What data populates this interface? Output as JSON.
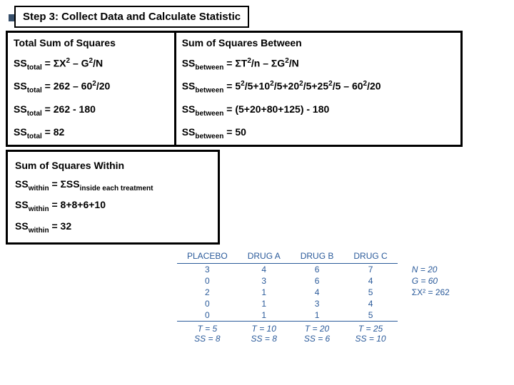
{
  "step_title": "Step 3: Collect Data and Calculate Statistic",
  "col1": {
    "header": "Total Sum of Squares",
    "r1a": "SS",
    "r1b": "total",
    "r1c": " = ΣX",
    "r1d": "2",
    "r1e": " – G",
    "r1f": "2",
    "r1g": "/N",
    "r2a": "SS",
    "r2b": "total",
    "r2c": " = 262 – 60",
    "r2d": "2",
    "r2e": "/20",
    "r3a": "SS",
    "r3b": "total",
    "r3c": " = 262 - 180",
    "r4a": "SS",
    "r4b": "total",
    "r4c": " = 82"
  },
  "col2": {
    "header": "Sum of Squares Between",
    "r1a": "SS",
    "r1b": "between",
    "r1c": " = ΣT",
    "r1d": "2",
    "r1e": "/n – ΣG",
    "r1f": "2",
    "r1g": "/N",
    "r2a": "SS",
    "r2b": "between",
    "r2c": " = 5",
    "r2d": "2",
    "r2e": "/5+10",
    "r2f": "2",
    "r2g": "/5+20",
    "r2h": "2",
    "r2i": "/5+25",
    "r2j": "2",
    "r2k": "/5 – 60",
    "r2l": "2",
    "r2m": "/20",
    "r3a": "SS",
    "r3b": "between",
    "r3c": " = (5+20+80+125) - 180",
    "r4a": "SS",
    "r4b": "between",
    "r4c": " = 50"
  },
  "within": {
    "header": "Sum of Squares Within",
    "r1a": "SS",
    "r1b": "within",
    "r1c": " = ΣSS",
    "r1d": "inside each treatment",
    "r2a": "SS",
    "r2b": "within",
    "r2c": " = 8+8+6+10",
    "r3a": "SS",
    "r3b": "within",
    "r3c": " = 32"
  },
  "datatable": {
    "h1": "PLACEBO",
    "h2": "DRUG A",
    "h3": "DRUG B",
    "h4": "DRUG C",
    "rows": [
      [
        "3",
        "4",
        "6",
        "7"
      ],
      [
        "0",
        "3",
        "6",
        "4"
      ],
      [
        "2",
        "1",
        "4",
        "5"
      ],
      [
        "0",
        "1",
        "3",
        "4"
      ],
      [
        "0",
        "1",
        "1",
        "5"
      ]
    ],
    "side": [
      "N = 20",
      "G = 60",
      "ΣX² = 262"
    ],
    "sumT": [
      "T = 5",
      "T = 10",
      "T = 20",
      "T = 25"
    ],
    "sumSS": [
      "SS = 8",
      "SS = 8",
      "SS = 6",
      "SS = 10"
    ]
  }
}
